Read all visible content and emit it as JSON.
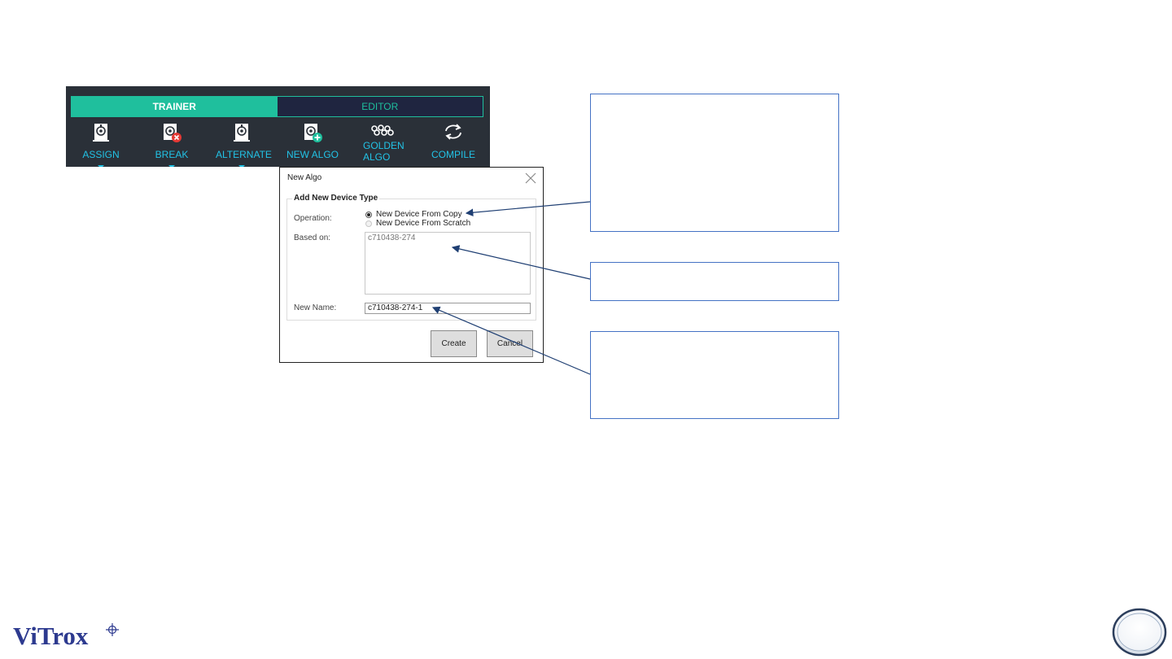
{
  "toolbar": {
    "tabs": [
      {
        "label": "TRAINER",
        "active": true
      },
      {
        "label": "EDITOR",
        "active": false
      }
    ],
    "tools": [
      {
        "label1": "ASSIGN",
        "label2": "",
        "icon": "assign-algo-icon",
        "has_dropdown": true
      },
      {
        "label1": "BREAK",
        "label2": "",
        "icon": "break-algo-icon",
        "has_dropdown": true
      },
      {
        "label1": "ALTERNATE",
        "label2": "",
        "icon": "alternate-algo-icon",
        "has_dropdown": true
      },
      {
        "label1": "NEW ALGO",
        "label2": "",
        "icon": "new-algo-icon",
        "has_dropdown": false
      },
      {
        "label1": "GOLDEN",
        "label2": "ALGO",
        "icon": "golden-algo-icon",
        "has_dropdown": false
      },
      {
        "label1": "COMPILE",
        "label2": "",
        "icon": "compile-icon",
        "has_dropdown": false
      }
    ],
    "colors": {
      "bg": "#2a3038",
      "accent": "#1fbf9d",
      "label": "#22c3e6"
    }
  },
  "dialog": {
    "title": "New Algo",
    "group_title": "Add New Device Type",
    "operation_label": "Operation:",
    "options": [
      {
        "label": "New Device From Copy",
        "selected": true
      },
      {
        "label": "New Device From Scratch",
        "selected": false
      }
    ],
    "based_on_label": "Based on:",
    "based_on_value": "c710438-274",
    "new_name_label": "New Name:",
    "new_name_value": "c710438-274-1",
    "create_button": "Create",
    "cancel_button": "Cancel"
  },
  "branding": {
    "logo_text": "ViTrox"
  }
}
